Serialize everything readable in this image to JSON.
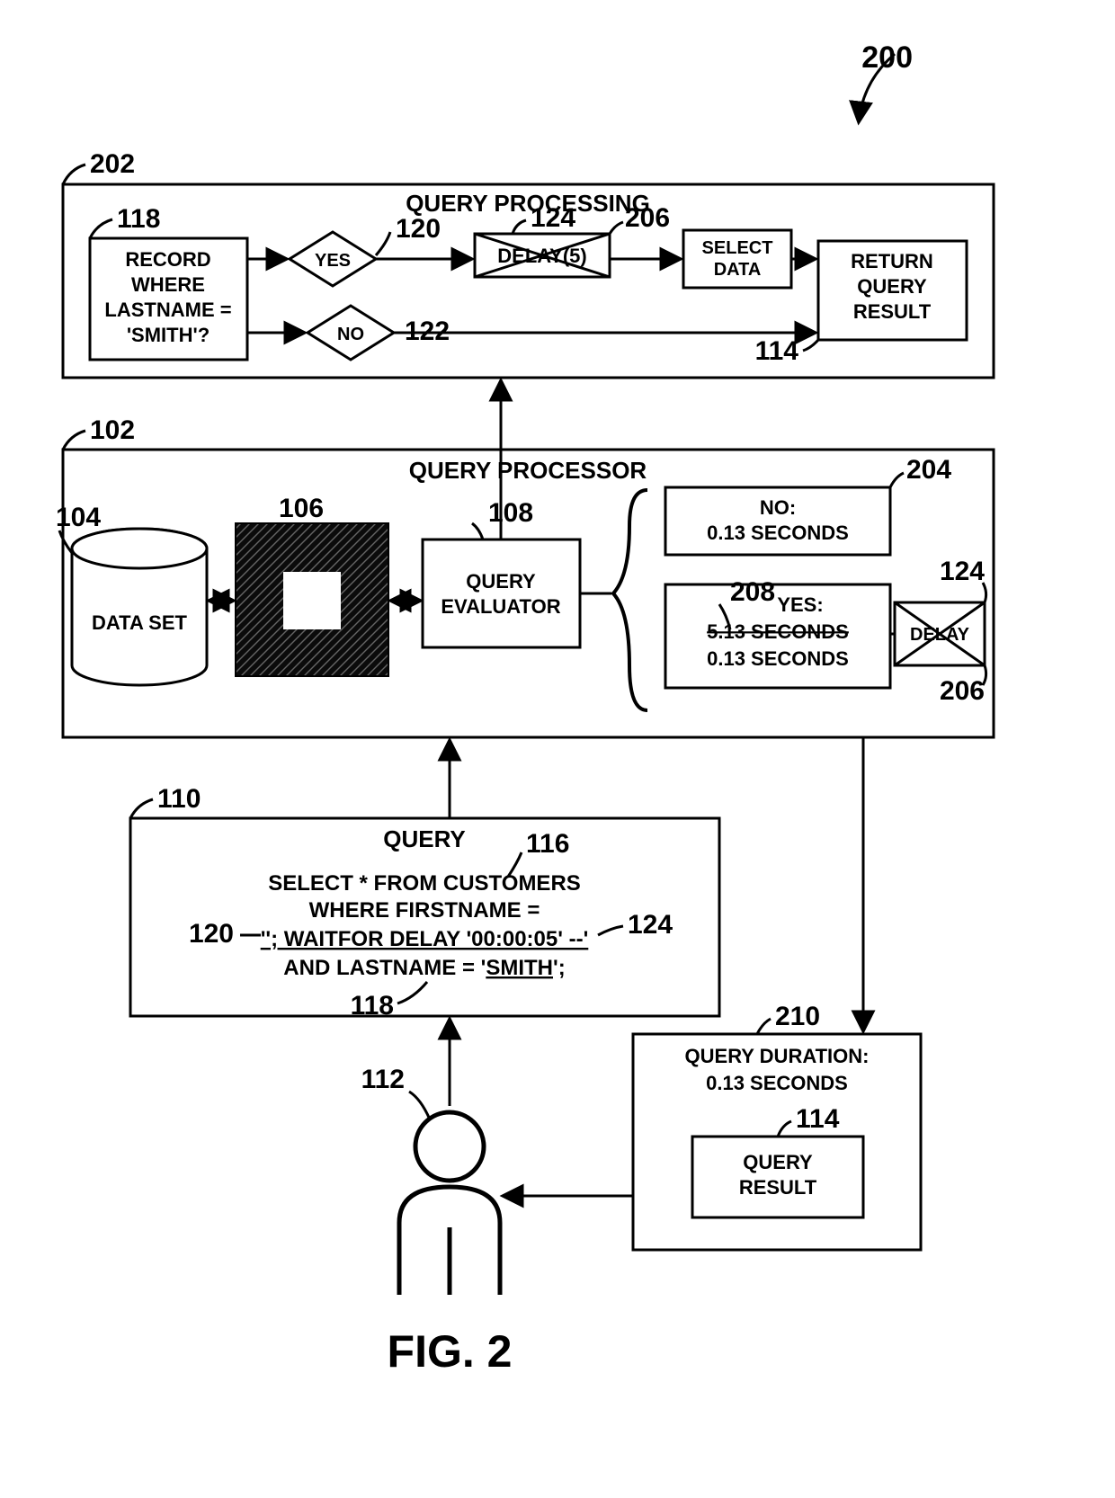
{
  "figure": {
    "caption": "FIG. 2",
    "ref_200": "200"
  },
  "query_processing": {
    "ref": "202",
    "title": "QUERY PROCESSING",
    "record_box": {
      "ref": "118",
      "line1": "RECORD",
      "line2": "WHERE",
      "line3": "LASTNAME =",
      "line4": "'SMITH'?"
    },
    "yes": {
      "text": "YES",
      "ref": "120"
    },
    "no": {
      "text": "NO",
      "ref": "122"
    },
    "delay": {
      "text": "DELAY(5)",
      "ref": "124",
      "cross_ref": "206"
    },
    "select_data": {
      "line1": "SELECT",
      "line2": "DATA"
    },
    "return": {
      "line1": "RETURN",
      "line2": "QUERY",
      "line3": "RESULT",
      "ref": "114"
    }
  },
  "query_processor": {
    "ref": "102",
    "title": "QUERY PROCESSOR",
    "data_set": {
      "label": "DATA SET",
      "ref": "104"
    },
    "chip": {
      "ref": "106"
    },
    "evaluator": {
      "line1": "QUERY",
      "line2": "EVALUATOR",
      "ref": "108"
    },
    "no_box": {
      "ref": "204",
      "line1": "NO:",
      "line2": "0.13 SECONDS"
    },
    "yes_box": {
      "ref": "208",
      "line1": "YES:",
      "line2": "5.13 SECONDS",
      "line3": "0.13 SECONDS"
    },
    "delay_box": {
      "text": "DELAY",
      "ref": "124",
      "cross_ref": "206"
    }
  },
  "query": {
    "ref": "110",
    "title": "QUERY",
    "sql1": "SELECT * FROM CUSTOMERS",
    "sql2": "WHERE FIRSTNAME =",
    "sql3": "''; WAITFOR DELAY '00:00:05' --'",
    "sql4a": "AND LASTNAME = '",
    "sql4b": "SMITH",
    "sql4c": "';",
    "ref_116": "116",
    "ref_120": "120",
    "ref_124": "124",
    "ref_118": "118"
  },
  "person": {
    "ref": "112"
  },
  "duration_box": {
    "ref": "210",
    "line1": "QUERY DURATION:",
    "line2": "0.13 SECONDS",
    "result_ref": "114",
    "result_line1": "QUERY",
    "result_line2": "RESULT"
  }
}
